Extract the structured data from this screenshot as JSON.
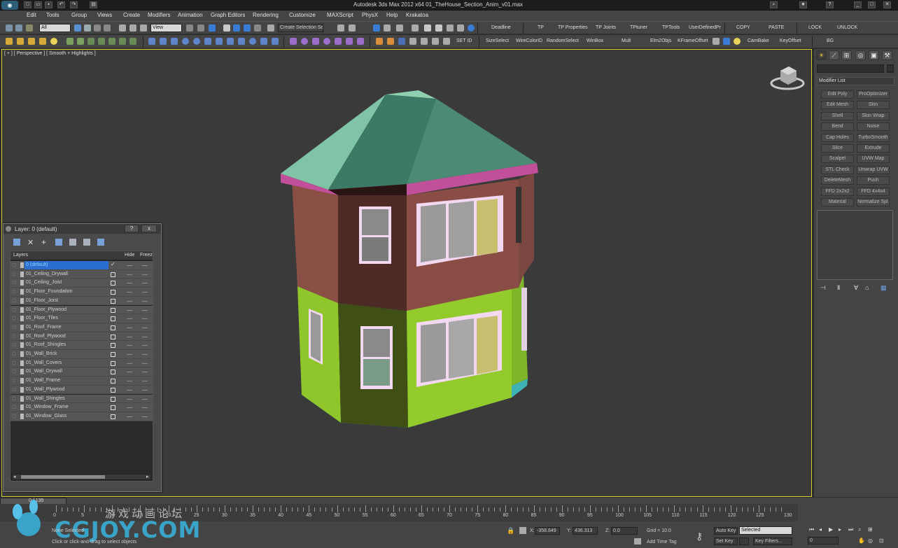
{
  "window": {
    "title": "Autodesk 3ds Max  2012 x64      01_TheHouse_Section_Anim_v01.max",
    "logo": "3ds-max-logo-icon"
  },
  "menu": [
    "Edit",
    "Tools",
    "Group",
    "Views",
    "Create",
    "Modifiers",
    "Animation",
    "Graph Editors",
    "Rendering",
    "Customize",
    "MAXScript",
    "PhysX",
    "Help",
    "Krakatoa"
  ],
  "toolbar1": {
    "selection_filter": "All",
    "ref_coord": "View",
    "selection_set_placeholder": "Create Selection Se",
    "script_buttons": [
      "Deadline",
      "TP",
      "TP Properties",
      "TP Joints",
      "TPtuner",
      "TPTools",
      "UserDefinedPr",
      "COPY",
      "PASTE",
      "LOCK",
      "UNLOCK"
    ]
  },
  "toolbar2": {
    "script_buttons": [
      "SET ID",
      "SizeSelect",
      "WireColorID",
      "RandomSelect",
      "WinBox",
      "Mult",
      "Elm2Objs",
      "KFrameOffset",
      "CamBake",
      "KeyOffset",
      "BG"
    ]
  },
  "viewport": {
    "label": "[ + ] [ Perspective ] [ Smooth + Highlights ]"
  },
  "command_panel": {
    "modifier_list": "Modifier List",
    "buttons": [
      "Edit Poly",
      "ProOptimizer",
      "Edit Mesh",
      "Skin",
      "Shell",
      "Skin Wrap",
      "Bend",
      "Noise",
      "Cap Holes",
      "TurboSmooth",
      "Slice",
      "Extrude",
      "Scalpel",
      "UVW Map",
      "STL Check",
      "Unwrap UVW",
      "DeleteMesh",
      "Push",
      "FFD 2x2x2",
      "FFD 4x4x4",
      "Material",
      "Normalize Spl."
    ]
  },
  "layer_window": {
    "title": "Layer: 0 (default)",
    "help": "?",
    "close": "x",
    "columns": {
      "layers": "Layers",
      "hide": "Hide",
      "freeze": "Freeze"
    },
    "rows": [
      "0 (default)",
      "01_Ceiling_Drywall",
      "01_Ceiling_Joist",
      "01_Floor_Foundation",
      "01_Floor_Joist",
      "01_Floor_Plywood",
      "01_Floor_Tiles",
      "01_Roof_Frame",
      "01_Roof_Plywood",
      "01_Roof_Shingles",
      "01_Wall_Brick",
      "01_Wall_Covers",
      "01_Wall_Drywall",
      "01_Wall_Frame",
      "01_Wall_Plywood",
      "01_Wall_Shingles",
      "01_Window_Frame",
      "01_Window_Glass"
    ],
    "active_row": 0
  },
  "timeline": {
    "frame_counter": "0 / 135",
    "ticks": [
      "0",
      "5",
      "10",
      "15",
      "20",
      "25",
      "30",
      "35",
      "40",
      "45",
      "50",
      "55",
      "60",
      "65",
      "70",
      "75",
      "80",
      "85",
      "90",
      "95",
      "100",
      "105",
      "110",
      "115",
      "120",
      "125",
      "130"
    ]
  },
  "status": {
    "selection": "None Selected",
    "prompt": "Click or click-and-drag to select objects",
    "x_label": "X:",
    "x_value": "-358.849",
    "y_label": "Y:",
    "y_value": "436.313",
    "z_label": "Z:",
    "z_value": "0.0",
    "grid": "Grid = 10.0",
    "auto_key": "Auto Key",
    "set_key": "Set Key",
    "key_filter": "Selected",
    "key_filters_btn": "Key Filters...",
    "add_time_tag": "Add Time Tag",
    "frame_field": "0"
  },
  "watermark": {
    "text": "CGJOY.COM",
    "cn": "游戏动画论坛"
  },
  "colors": {
    "viewport": "#3a3a3a",
    "viewport_border": "#d9d02f",
    "roof": "#7fc4a6",
    "wall_upper": "#8a5045",
    "wall_lower": "#8fc62b",
    "trim": "#c0509a",
    "base": "#3fb3b3"
  }
}
